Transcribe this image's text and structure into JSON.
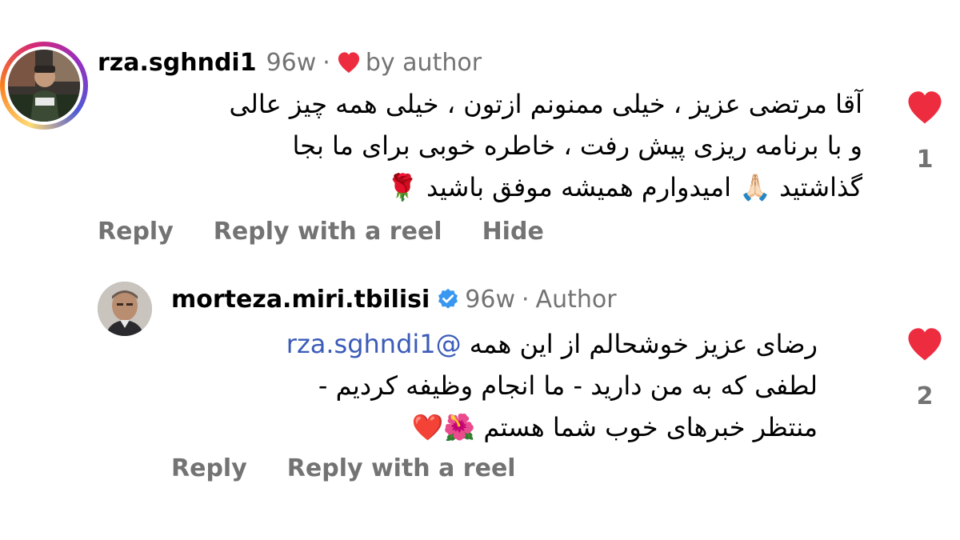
{
  "colors": {
    "like_red": "#ed2d3f",
    "muted_gray": "#737373",
    "mention_blue": "#3b5bb8",
    "verified_blue": "#3897f0"
  },
  "comments": [
    {
      "username": "rza.sghndi1",
      "time": "96w",
      "separator": "·",
      "badge_icon": "heart-icon",
      "badge_text": "by author",
      "lines": [
        "آقا مرتضی عزیز ، خیلی ممنونم ازتون ، خیلی همه چیز عالی",
        "و با برنامه ریزی پیش رفت ، خاطره خوبی برای ما بجا",
        "گذاشتید 🙏🏻 امیدوارم همیشه موفق باشید 🌹"
      ],
      "actions": [
        "Reply",
        "Reply with a reel",
        "Hide"
      ],
      "like_count": "1"
    },
    {
      "username": "morteza.miri.tbilisi",
      "verified_icon": "verified-badge-icon",
      "time": "96w",
      "separator": "·",
      "role": "Author",
      "line1_text": "رضای عزیز خوشحالم از این همه ",
      "line1_mention": "@rza.sghndi1",
      "lines": [
        "لطفی که به من دارید - ما انجام وظیفه کردیم -",
        "منتظر خبرهای خوب شما هستم 🌺❤️"
      ],
      "actions": [
        "Reply",
        "Reply with a reel"
      ],
      "like_count": "2"
    }
  ]
}
